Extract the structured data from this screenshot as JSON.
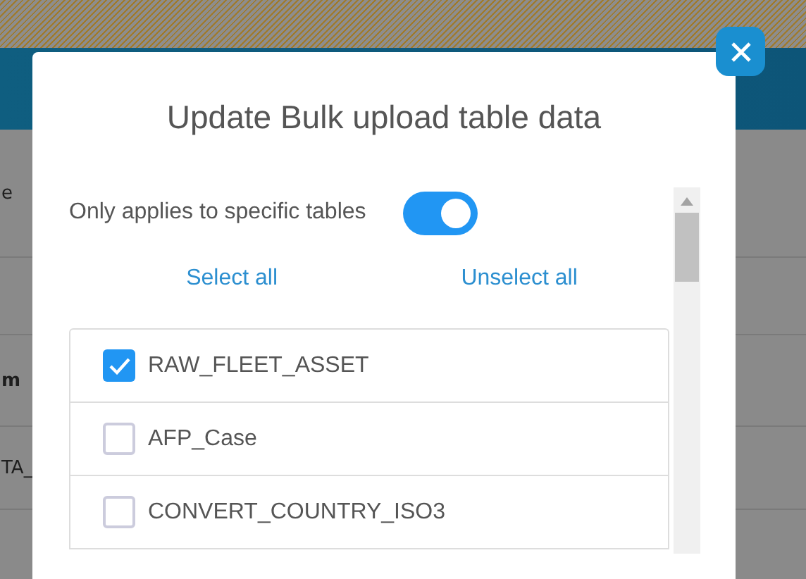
{
  "background": {
    "texts": [
      {
        "text": "e",
        "kind": "plain"
      },
      {
        "text": "m",
        "kind": "heading"
      },
      {
        "text": "TA_",
        "kind": "plain"
      }
    ]
  },
  "dialog": {
    "title": "Update Bulk upload table data",
    "toggle": {
      "label": "Only applies to specific tables",
      "on": true
    },
    "links": [
      "Select all",
      "Unselect all"
    ],
    "tables": [
      {
        "name": "RAW_FLEET_ASSET",
        "checked": true
      },
      {
        "name": "AFP_Case",
        "checked": false
      },
      {
        "name": "CONVERT_COUNTRY_ISO3",
        "checked": false
      }
    ]
  }
}
